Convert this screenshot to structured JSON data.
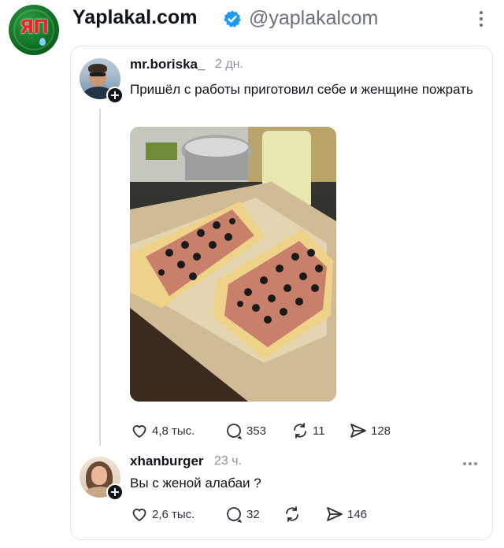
{
  "account": {
    "name": "Yaplakal.com",
    "handle": "@yaplakalcom",
    "logo_text": "ЯП",
    "verified_color": "#1d9bf0",
    "logo_color": "#0d6b21"
  },
  "post": {
    "username": "mr.boriska_",
    "time": "2 дн.",
    "text": "Пришёл с работы приготовил себе и женщине пожрать",
    "image_description": "baking tray with two rectangular pizzas topped with ham and black olives",
    "stats": {
      "likes": "4,8 тыс.",
      "comments": "353",
      "reposts": "11",
      "shares": "128"
    }
  },
  "reply": {
    "username": "xhanburger",
    "time": "23 ч.",
    "text": "Вы с женой алабаи ?",
    "stats": {
      "likes": "2,6 тыс.",
      "comments": "32",
      "reposts": "",
      "shares": "146"
    }
  },
  "icons": {
    "like": "heart-icon",
    "comment": "comment-bubble-icon",
    "repost": "repost-icon",
    "share": "send-icon",
    "follow": "plus-icon",
    "menu": "more-icon"
  }
}
